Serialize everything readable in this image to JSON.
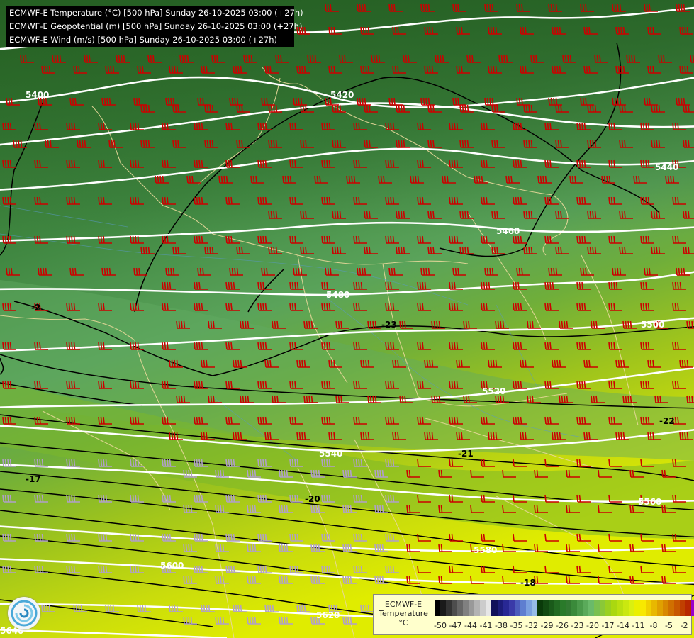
{
  "titles": [
    "ECMWF-E Temperature (°C) [500 hPa] Sunday 26-10-2025 03:00 (+27h)",
    "ECMWF-E Geopotential (m) [500 hPa] Sunday 26-10-2025 03:00 (+27h)",
    "ECMWF-E Wind (m/s) [500 hPa] Sunday 26-10-2025 03:00 (+27h)"
  ],
  "geopotential_labels": [
    "5400",
    "5420",
    "5440",
    "5460",
    "5480",
    "5500",
    "5520",
    "5540",
    "5560",
    "5580",
    "5600",
    "5620",
    "5640"
  ],
  "temperature_labels": [
    "-23",
    "-22",
    "-21",
    "-20",
    "-18",
    "-17",
    "-2"
  ],
  "legend": {
    "title_line1": "ECMWF-E",
    "title_line2": "Temperature",
    "unit": "°C",
    "ticks": [
      "-50",
      "-47",
      "-44",
      "-41",
      "-38",
      "-35",
      "-32",
      "-29",
      "-26",
      "-23",
      "-20",
      "-17",
      "-14",
      "-11",
      "-8",
      "-5",
      "-2"
    ],
    "colors": [
      "#000000",
      "#1a1a1a",
      "#333333",
      "#4d4d4d",
      "#666666",
      "#808080",
      "#999999",
      "#b3b3b3",
      "#cccccc",
      "#e6e6e6",
      "#10105a",
      "#1c1c7a",
      "#282894",
      "#3a3aa8",
      "#4c5cbc",
      "#5e7ed0",
      "#7aa0e0",
      "#96bce8",
      "#0a3a0a",
      "#124a12",
      "#1a5a1a",
      "#226a22",
      "#2a7a2a",
      "#327a32",
      "#3a8a3a",
      "#4a9a4a",
      "#5aaa5a",
      "#6aba6a",
      "#7ac050",
      "#8ac838",
      "#9ad020",
      "#aad810",
      "#bae010",
      "#cae810",
      "#daf010",
      "#eaf000",
      "#f8e800",
      "#f0d000",
      "#e8b800",
      "#e0a000",
      "#d88800",
      "#d07000",
      "#c85800",
      "#c04000",
      "#b82800",
      "#9900cc",
      "#8800ff",
      "#7a00e0"
    ]
  },
  "colors": {
    "isohypse": "#ffffff",
    "isotherm": "#000000",
    "border": "#e8d89a",
    "wind_barb": "#cc0000",
    "wind_barb_light": "#b0a0c8"
  }
}
